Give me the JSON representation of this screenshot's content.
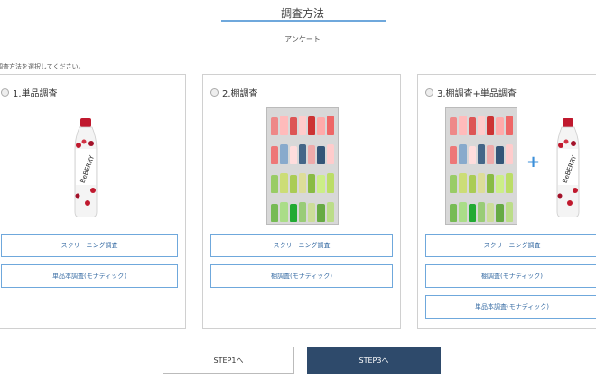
{
  "header": {
    "title": "調査方法",
    "subtitle": "アンケート"
  },
  "instruction": "調査方法を選択してください。",
  "cards": [
    {
      "label": "1.単品調査",
      "options": [
        "スクリーニング調査",
        "単品本調査(モナディック)"
      ]
    },
    {
      "label": "2.棚調査",
      "options": [
        "スクリーニング調査",
        "棚調査(モナディック)"
      ]
    },
    {
      "label": "3.棚調査+単品調査",
      "options": [
        "スクリーニング調査",
        "棚調査(モナディック)",
        "単品本調査(モナディック)"
      ],
      "plus": "+"
    }
  ],
  "footer": {
    "back_label": "STEP1へ",
    "next_label": "STEP3へ"
  },
  "colors": {
    "accent": "#6fa8dc",
    "primary_button": "#2e4a6b"
  },
  "icons": [
    "radio-icon",
    "bottle-image",
    "shelf-image",
    "plus-icon"
  ]
}
